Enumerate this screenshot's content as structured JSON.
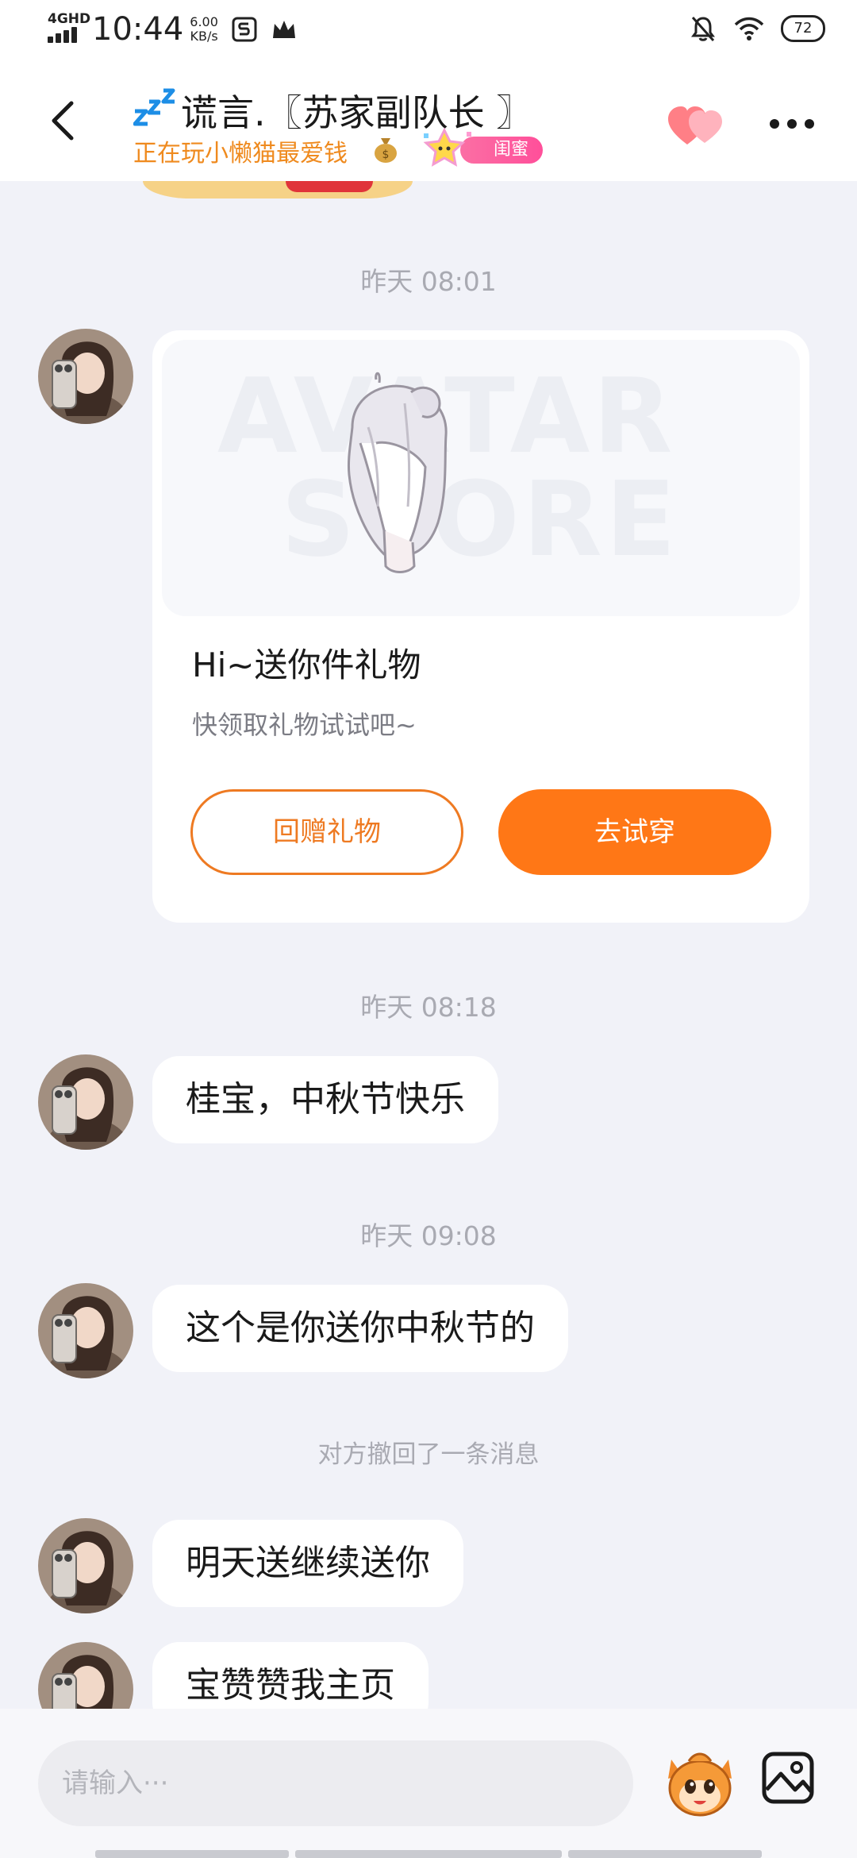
{
  "status_bar": {
    "network": "4GHD",
    "time": "10:44",
    "speed_value": "6.00",
    "speed_unit": "KB/s",
    "battery": "72"
  },
  "header": {
    "title": "谎言.〖苏家副队长 〗",
    "subtitle": "正在玩小懒猫最爱钱",
    "relation_badge": "闺蜜",
    "back_icon": "back-chevron-icon",
    "more_icon": "more-dots-icon",
    "hearts_icon": "double-heart-icon"
  },
  "chat": {
    "timestamps": [
      "昨天 08:01",
      "昨天 08:18",
      "昨天 09:08"
    ],
    "gift_card": {
      "image_watermark_1": "AVATAR",
      "image_watermark_2": "STORE",
      "title": "Hi~送你件礼物",
      "subtitle": "快领取礼物试试吧~",
      "return_gift_label": "回赠礼物",
      "try_on_label": "去试穿"
    },
    "messages": [
      "桂宝，中秋节快乐",
      "这个是你送你中秋节的",
      "明天送继续送你",
      "宝赞赞我主页"
    ],
    "recall_notice": "对方撤回了一条消息"
  },
  "input_bar": {
    "placeholder": "请输入···",
    "emoji_icon": "mascot-emoji-icon",
    "photo_icon": "photo-icon"
  },
  "colors": {
    "accent_orange": "#ff7716",
    "subtitle_orange": "#ef8a1e",
    "badge_pink": "#ff4f9a",
    "background": "#f1f2f8"
  }
}
